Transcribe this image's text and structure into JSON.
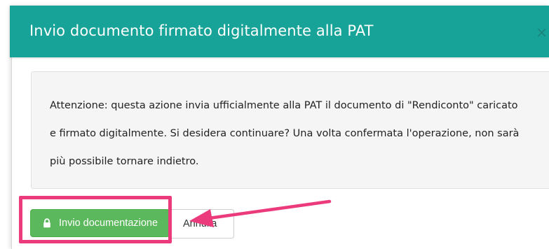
{
  "modal": {
    "title": "Invio documento firmato digitalmente alla PAT",
    "close_symbol": "×",
    "message": "Attenzione: questa azione invia ufficialmente alla PAT il documento di \"Rendiconto\" caricato e firmato digitalmente. Si desidera continuare? Una volta confermata l'operazione, non sarà più possibile tornare indietro.",
    "submit_label": "Invio documentazione",
    "submit_icon": "lock-icon",
    "cancel_label": "Annulla"
  },
  "annotation": {
    "highlight_color": "#ec3b7c",
    "arrow_color": "#ec3b7c"
  },
  "colors": {
    "header": "#17a398",
    "submit_button": "#5cb85c"
  }
}
